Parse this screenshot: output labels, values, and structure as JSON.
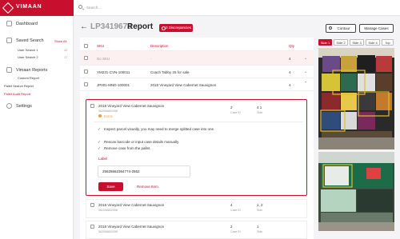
{
  "app": {
    "brand": "VIMAAN"
  },
  "sidebar": {
    "dashboard": "Dashboard",
    "saved_search": "Saved Search",
    "show_all": "Show All",
    "user_searches": [
      {
        "label": "User Search 1",
        "count": "42"
      },
      {
        "label": "User Search 2",
        "count": "17"
      }
    ],
    "vimaan_reports": "Vimaan Reports",
    "custom_report": "Custom Report",
    "pallet_search_report": "Pallet Search Report",
    "pallet_audit_report": "Pallet Audit Report",
    "settings": "Settings"
  },
  "topbar": {
    "search_placeholder": "Search..."
  },
  "header": {
    "report_id": "LP3419673",
    "title": "Report",
    "discrepancies": "3 Discrepancies",
    "contour_label": "Contour",
    "manage_cases_label": "Manage Cases"
  },
  "table": {
    "columns": {
      "sku": "SKU",
      "description": "Description",
      "qty": "Qty"
    },
    "rows": [
      {
        "sku": "No SKU",
        "description": "-",
        "qty": "4"
      },
      {
        "sku": "YM231-CVN-100011",
        "description": "Coach Tabby 26 for sale",
        "qty": "4"
      },
      {
        "sku": "JP001-MND-100001",
        "description": "2018 Vineyard View Cabernet Sauvignon",
        "qty": "4"
      }
    ]
  },
  "expanded": {
    "name": "2018 Vineyard View Cabernet Sauvignon",
    "code": "562056802058",
    "status": "Extra",
    "case_id_value": "2",
    "case_id_label": "Case ID",
    "side_value": "4  1",
    "side_label": "Side",
    "instructions": [
      "Inspect parcel visually, you may need to merge splitted case into one.",
      "Rescan barcode or input case details manually.",
      "Remove case from the pallet."
    ],
    "label_title": "Label",
    "label_value": "25625662364774-2552",
    "save_label": "Save",
    "remove_label": "Remove Item"
  },
  "cases": [
    {
      "name": "2018 Vineyard View Cabernet Sauvignon",
      "code": "562056802058",
      "case_id": "4",
      "case_id_label": "Case ID",
      "side": "1, 2",
      "side_label": "Side"
    },
    {
      "name": "2018 Vineyard View Cabernet Sauvignon",
      "code": "562056802058",
      "case_id": "2",
      "case_id_label": "Case ID",
      "side": "1",
      "side_label": "Side"
    }
  ],
  "image_tabs": [
    "Side 1",
    "Side 2",
    "Side 3",
    "Side 4",
    "Top"
  ],
  "colors": {
    "brand": "#c8102e",
    "status_extra": "#e8a33c"
  },
  "icons": {
    "back": "arrow-left-icon",
    "search": "search-icon",
    "expand": "chevron-down-icon"
  }
}
